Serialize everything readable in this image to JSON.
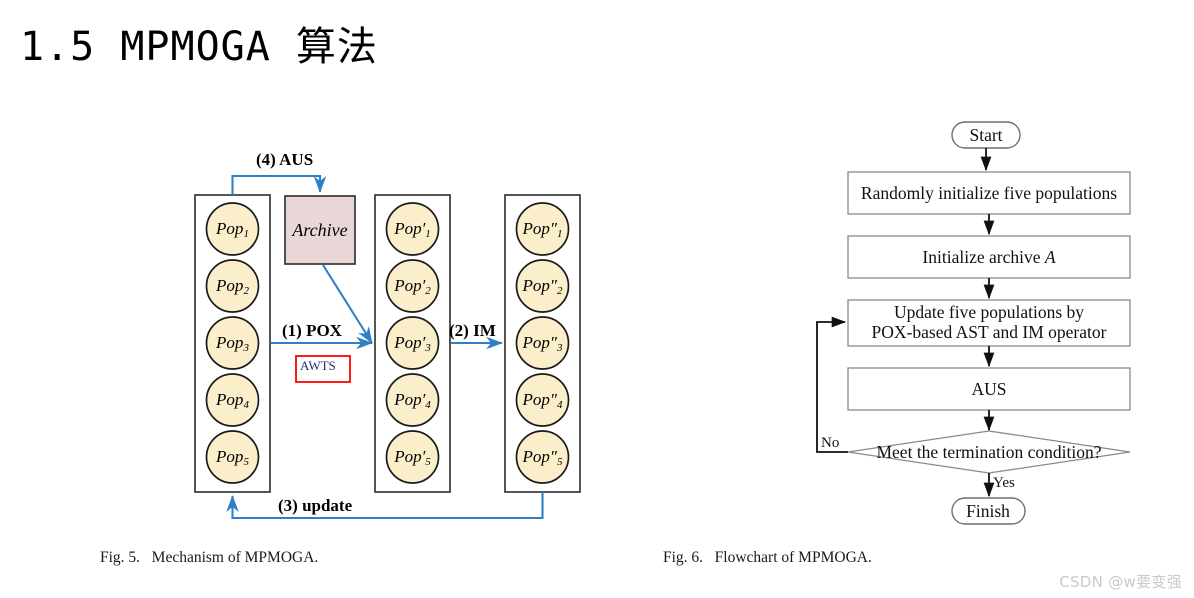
{
  "page": {
    "title": "1.5 MPMOGA 算法",
    "watermark": "CSDN @w要变强"
  },
  "fig5": {
    "caption": "Fig. 5.   Mechanism of MPMOGA.",
    "colors": {
      "circle_fill": "#fbeecb",
      "circle_stroke": "#1a1a1a",
      "archive_fill": "#e9d7d7",
      "archive_stroke": "#2b2b2b",
      "arrow_blue": "#2f7fc4",
      "awts_border": "#ff0000",
      "column_stroke": "#2b2b2b"
    },
    "archive_label": "Archive",
    "awts_label": "AWTS",
    "steps": {
      "aus": "(4) AUS",
      "pox": "(1) POX",
      "im": "(2) IM",
      "update": "(3) update"
    },
    "columns": [
      {
        "name": "population-column-1",
        "nodes": [
          {
            "base": "Pop",
            "prime": "",
            "sub": "1"
          },
          {
            "base": "Pop",
            "prime": "",
            "sub": "2"
          },
          {
            "base": "Pop",
            "prime": "",
            "sub": "3"
          },
          {
            "base": "Pop",
            "prime": "",
            "sub": "4"
          },
          {
            "base": "Pop",
            "prime": "",
            "sub": "5"
          }
        ]
      },
      {
        "name": "population-column-2",
        "nodes": [
          {
            "base": "Pop",
            "prime": "′",
            "sub": "1"
          },
          {
            "base": "Pop",
            "prime": "′",
            "sub": "2"
          },
          {
            "base": "Pop",
            "prime": "′",
            "sub": "3"
          },
          {
            "base": "Pop",
            "prime": "′",
            "sub": "4"
          },
          {
            "base": "Pop",
            "prime": "′",
            "sub": "5"
          }
        ]
      },
      {
        "name": "population-column-3",
        "nodes": [
          {
            "base": "Pop",
            "prime": "″",
            "sub": "1"
          },
          {
            "base": "Pop",
            "prime": "″",
            "sub": "2"
          },
          {
            "base": "Pop",
            "prime": "″",
            "sub": "3"
          },
          {
            "base": "Pop",
            "prime": "″",
            "sub": "4"
          },
          {
            "base": "Pop",
            "prime": "″",
            "sub": "5"
          }
        ]
      }
    ]
  },
  "fig6": {
    "caption": "Fig. 6.   Flowchart of MPMOGA.",
    "colors": {
      "box_stroke": "#8a8a8a",
      "arrow": "#111111",
      "terminal_stroke": "#6f6f6f"
    },
    "nodes": [
      {
        "id": "start",
        "type": "terminal",
        "text": "Start"
      },
      {
        "id": "init-pop",
        "type": "process",
        "text": "Randomly initialize five populations"
      },
      {
        "id": "init-arch",
        "type": "process",
        "text_prefix": "Initialize archive ",
        "text_italic": "A"
      },
      {
        "id": "update-pop",
        "type": "process",
        "line1": "Update five populations by",
        "line2": "POX-based AST and IM operator"
      },
      {
        "id": "aus",
        "type": "process",
        "text": "AUS"
      },
      {
        "id": "decision",
        "type": "decision",
        "text": "Meet the termination condition?"
      },
      {
        "id": "finish",
        "type": "terminal",
        "text": "Finish"
      }
    ],
    "branches": {
      "no": "No",
      "yes": "Yes"
    }
  }
}
